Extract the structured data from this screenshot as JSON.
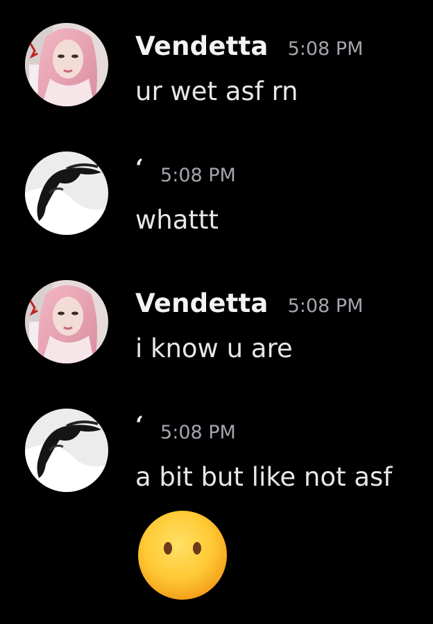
{
  "messages": [
    {
      "username": "Vendetta",
      "timestamp": "5:08 PM",
      "text": "ur wet asf rn",
      "avatar_icon": "pink-hair-avatar"
    },
    {
      "username": "‘",
      "timestamp": "5:08 PM",
      "text": "whattt",
      "avatar_icon": "dark-hair-avatar"
    },
    {
      "username": "Vendetta",
      "timestamp": "5:08 PM",
      "text": "i know u are",
      "avatar_icon": "pink-hair-avatar"
    },
    {
      "username": "‘",
      "timestamp": "5:08 PM",
      "text": "a bit but like not asf",
      "avatar_icon": "dark-hair-avatar",
      "attachment": "face-without-mouth-emoji"
    }
  ],
  "colors": {
    "background": "#000000",
    "username": "#f2f3f5",
    "timestamp": "#a3a6ad",
    "message_text": "#e6e7ea",
    "emoji_yellow": "#ffcc33"
  }
}
